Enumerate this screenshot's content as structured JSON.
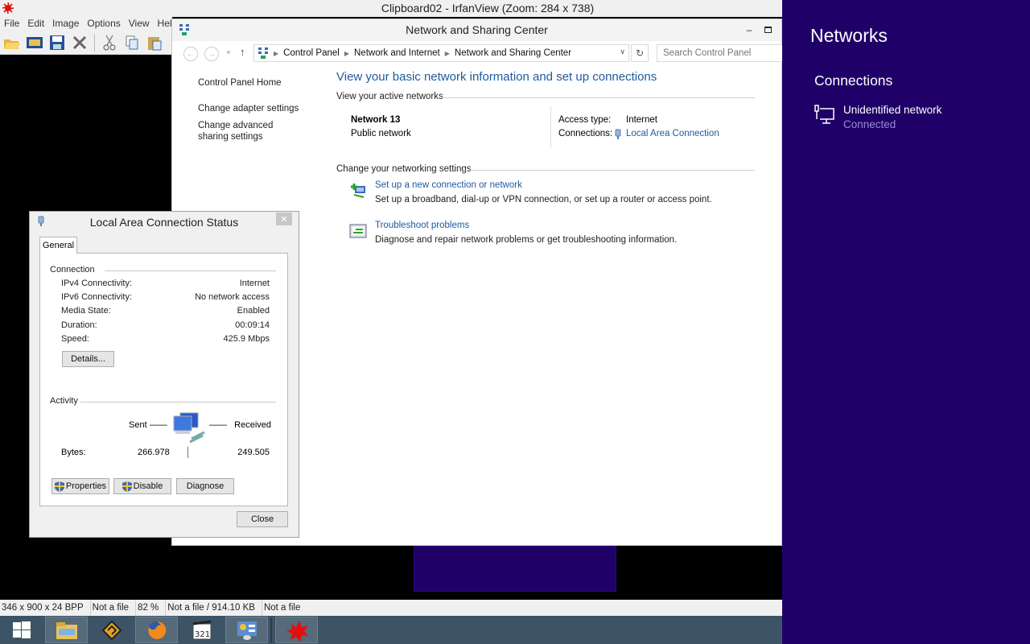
{
  "irfanview": {
    "title": "Clipboard02 - IrfanView (Zoom: 284 x 738)",
    "menu": [
      "File",
      "Edit",
      "Image",
      "Options",
      "View",
      "Help"
    ],
    "toolbar": [
      "open-icon",
      "slideshow-icon",
      "save-icon",
      "delete-icon",
      "cut-icon",
      "copy-icon",
      "paste-icon"
    ],
    "status": [
      "346 x 900 x 24 BPP",
      "Not a file",
      "82 %",
      "Not a file / 914.10 KB",
      "Not a file"
    ]
  },
  "nsc": {
    "title": "Network and Sharing Center",
    "breadcrumb": [
      "Control Panel",
      "Network and Internet",
      "Network and Sharing Center"
    ],
    "search_placeholder": "Search Control Panel",
    "sidebar": [
      "Control Panel Home",
      "Change adapter settings",
      "Change advanced sharing settings"
    ],
    "heading": "View your basic network information and set up connections",
    "active_networks_label": "View your active networks",
    "network": {
      "name": "Network  13",
      "type": "Public network",
      "access_type_label": "Access type:",
      "access_type": "Internet",
      "connections_label": "Connections:",
      "connection": "Local Area Connection"
    },
    "change_settings_label": "Change your networking settings",
    "tasks": [
      {
        "link": "Set up a new connection or network",
        "desc": "Set up a broadband, dial-up or VPN connection, or set up a router or access point."
      },
      {
        "link": "Troubleshoot problems",
        "desc": "Diagnose and repair network problems or get troubleshooting information."
      }
    ]
  },
  "lac": {
    "title": "Local Area Connection Status",
    "tab": "General",
    "connection_label": "Connection",
    "rows": [
      {
        "k": "IPv4 Connectivity:",
        "v": "Internet"
      },
      {
        "k": "IPv6 Connectivity:",
        "v": "No network access"
      },
      {
        "k": "Media State:",
        "v": "Enabled"
      },
      {
        "k": "Duration:",
        "v": "00:09:14"
      },
      {
        "k": "Speed:",
        "v": "425.9 Mbps"
      }
    ],
    "details_button": "Details...",
    "activity_label": "Activity",
    "sent_label": "Sent",
    "received_label": "Received",
    "bytes_label": "Bytes:",
    "bytes_sent": "266.978",
    "bytes_received": "249.505",
    "properties_button": "Properties",
    "disable_button": "Disable",
    "diagnose_button": "Diagnose",
    "close_button": "Close"
  },
  "charm": {
    "title": "Networks",
    "section": "Connections",
    "network_name": "Unidentified network",
    "network_status": "Connected"
  },
  "taskbar": [
    "start-icon",
    "file-explorer-icon",
    "winamp-icon",
    "firefox-icon",
    "media-player-classic-icon",
    "control-panel-icon",
    "irfanview-icon"
  ]
}
